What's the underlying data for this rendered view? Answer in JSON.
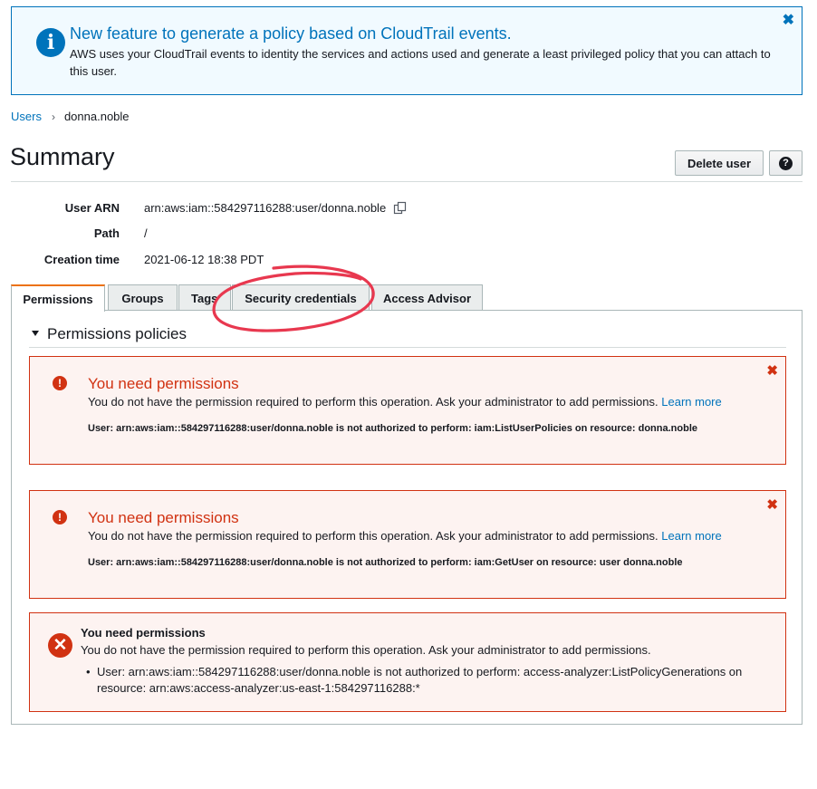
{
  "banner": {
    "title": "New feature to generate a policy based on CloudTrail events.",
    "text": "AWS uses your CloudTrail events to identity the services and actions used and generate a least privileged policy that you can attach to this user.",
    "icon": "info-icon",
    "close_icon": "close-icon"
  },
  "breadcrumb": {
    "parent": "Users",
    "separator": "›",
    "current": "donna.noble"
  },
  "page": {
    "title": "Summary",
    "delete_button": "Delete user",
    "help_button": "?"
  },
  "details": {
    "arn_label": "User ARN",
    "arn_value": "arn:aws:iam::584297116288:user/donna.noble",
    "path_label": "Path",
    "path_value": "/",
    "created_label": "Creation time",
    "created_value": "2021-06-12 18:38 PDT"
  },
  "tabs": [
    {
      "label": "Permissions",
      "active": true
    },
    {
      "label": "Groups",
      "active": false
    },
    {
      "label": "Tags",
      "active": false
    },
    {
      "label": "Security credentials",
      "active": false
    },
    {
      "label": "Access Advisor",
      "active": false
    }
  ],
  "permissions": {
    "section_title": "Permissions policies",
    "errors": [
      {
        "title": "You need permissions",
        "text": "You do not have the permission required to perform this operation. Ask your administrator to add permissions.",
        "link": "Learn more",
        "detail": "User: arn:aws:iam::584297116288:user/donna.noble is not authorized to perform: iam:ListUserPolicies on resource: donna.noble"
      },
      {
        "title": "You need permissions",
        "text": "You do not have the permission required to perform this operation. Ask your administrator to add permissions.",
        "link": "Learn more",
        "detail": "User: arn:aws:iam::584297116288:user/donna.noble is not authorized to perform: iam:GetUser on resource: user donna.noble"
      }
    ],
    "analyzer_error": {
      "title": "You need permissions",
      "text": "You do not have the permission required to perform this operation. Ask your administrator to add permissions.",
      "bullet": "User: arn:aws:iam::584297116288:user/donna.noble is not authorized to perform: access-analyzer:ListPolicyGenerations on resource: arn:aws:access-analyzer:us-east-1:584297116288:*"
    }
  },
  "colors": {
    "accent_blue": "#0073bb",
    "error_red": "#d13212",
    "active_tab_orange": "#ec7211",
    "annotation_red": "#e8384f"
  }
}
